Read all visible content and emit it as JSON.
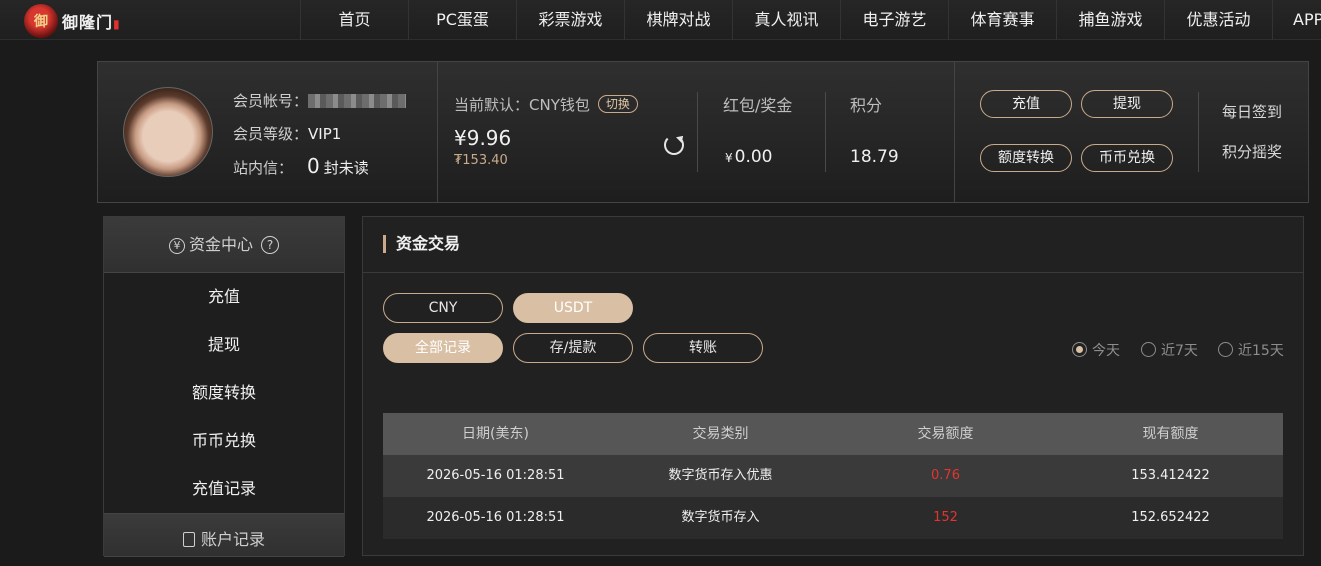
{
  "brand": {
    "logo_mark": "御",
    "name": "御隆门"
  },
  "nav": {
    "items": [
      "首页",
      "PC蛋蛋",
      "彩票游戏",
      "棋牌对战",
      "真人视讯",
      "电子游艺",
      "体育赛事",
      "捕鱼游戏",
      "优惠活动",
      "APP"
    ]
  },
  "member": {
    "account_label": "会员帐号：",
    "level_label": "会员等级：",
    "level_value": "VIP1",
    "message_label": "站内信：",
    "unread_count": "0",
    "unread_suffix": "封未读",
    "wallet_label": "当前默认：CNY钱包",
    "switch_label": "切换",
    "balance": "¥9.96",
    "balance_sub": "₮153.40",
    "bonus_label": "红包/奖金",
    "bonus_currency": "¥",
    "bonus_value": "0.00",
    "points_label": "积分",
    "points_value": "18.79",
    "buttons": {
      "deposit": "充值",
      "withdraw": "提现",
      "transfer": "额度转换",
      "exchange": "币币兑换"
    },
    "links": {
      "checkin": "每日签到",
      "lottery": "积分摇奖"
    }
  },
  "sidebar": {
    "section_title": "资金中心",
    "help": "?",
    "section_icon": "¥",
    "items": [
      "充值",
      "提现",
      "额度转换",
      "币币兑换",
      "充值记录"
    ],
    "second_section": "账户记录"
  },
  "main": {
    "title": "资金交易",
    "currency_tabs": [
      "CNY",
      "USDT"
    ],
    "active_currency": "USDT",
    "type_tabs": [
      "全部记录",
      "存/提款",
      "转账"
    ],
    "active_type": "全部记录",
    "ranges": [
      "今天",
      "近7天",
      "近15天"
    ],
    "active_range": "今天",
    "columns": [
      "日期(美东)",
      "交易类别",
      "交易额度",
      "现有额度"
    ],
    "rows": [
      [
        "2026-05-16 01:28:51",
        "数字货币存入优惠",
        "0.76",
        "153.412422"
      ],
      [
        "2026-05-16 01:28:51",
        "数字货币存入",
        "152",
        "152.652422"
      ]
    ]
  },
  "colors": {
    "accent": "#c9ab8c",
    "active_fill": "#d9bfa3",
    "amount_red": "#e3342f"
  }
}
